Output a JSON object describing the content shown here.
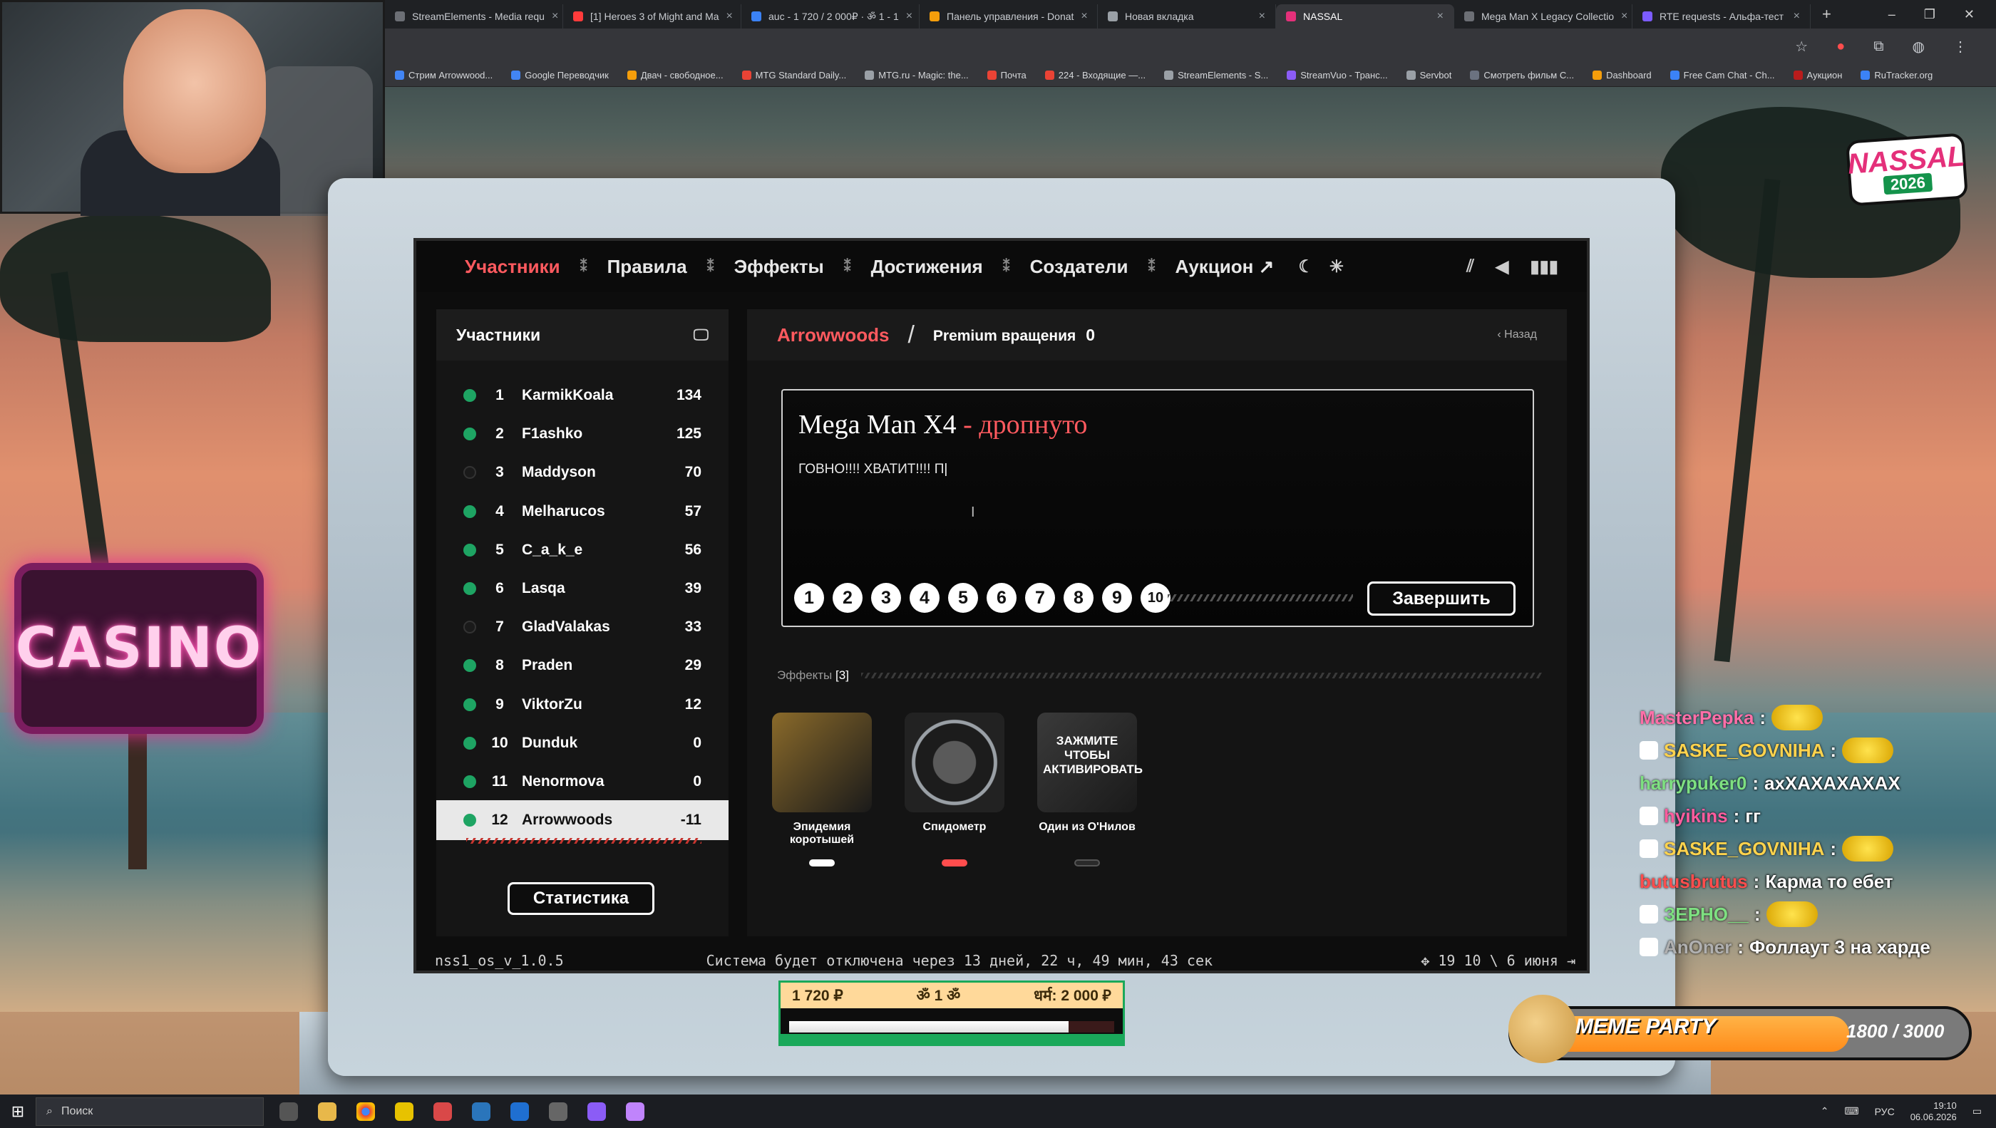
{
  "browser": {
    "tabs": [
      {
        "title": "StreamElements - Media requ",
        "color": "#6c6f75"
      },
      {
        "title": "[1] Heroes 3 of Might and Ma",
        "color": "#ff3b3b"
      },
      {
        "title": "auc - 1 720 / 2 000₽ · ॐ 1 - 1",
        "color": "#3b82f6"
      },
      {
        "title": "Панель управления - Donat",
        "color": "#f59e0b"
      },
      {
        "title": "Новая вкладка",
        "color": "#9aa0a6"
      },
      {
        "title": "NASSAL",
        "color": "#e4307a",
        "active": true
      },
      {
        "title": "Mega Man X Legacy Collectio",
        "color": "#6c6f75"
      },
      {
        "title": "RTE requests - Альфа-тест",
        "color": "#7c5cff"
      }
    ],
    "bookmarks": [
      "Стрим Arrowwood...",
      "Google Переводчик",
      "Двач - свободное...",
      "MTG Standard Daily...",
      "MTG.ru - Magic: the...",
      "Почта",
      "224 - Входящие —...",
      "StreamElements - S...",
      "StreamVuo - Транс...",
      "Servbot",
      "Смотреть фильм С...",
      "Dashboard",
      "Free Cam Chat - Ch...",
      "Аукцион",
      "RuTracker.org"
    ]
  },
  "scene": {
    "sign_text": "CASINO"
  },
  "nav": {
    "items": [
      "Участники",
      "Правила",
      "Эффекты",
      "Достижения",
      "Создатели",
      "Аукцион ↗"
    ],
    "active_index": 0
  },
  "participants": {
    "title": "Участники",
    "rows": [
      {
        "rank": "1",
        "name": "KarmikKoala",
        "score": "134",
        "online": true
      },
      {
        "rank": "2",
        "name": "F1ashko",
        "score": "125",
        "online": true
      },
      {
        "rank": "3",
        "name": "Maddyson",
        "score": "70",
        "online": false
      },
      {
        "rank": "4",
        "name": "Melharucos",
        "score": "57",
        "online": true
      },
      {
        "rank": "5",
        "name": "C_a_k_e",
        "score": "56",
        "online": true
      },
      {
        "rank": "6",
        "name": "Lasqa",
        "score": "39",
        "online": true
      },
      {
        "rank": "7",
        "name": "GladValakas",
        "score": "33",
        "online": false
      },
      {
        "rank": "8",
        "name": "Praden",
        "score": "29",
        "online": true
      },
      {
        "rank": "9",
        "name": "ViktorZu",
        "score": "12",
        "online": true
      },
      {
        "rank": "10",
        "name": "Dunduk",
        "score": "0",
        "online": true
      },
      {
        "rank": "11",
        "name": "Nenormova",
        "score": "0",
        "online": true
      },
      {
        "rank": "12",
        "name": "Arrowwoods",
        "score": "-11",
        "online": true,
        "selected": true
      }
    ],
    "stats_button": "Статистика"
  },
  "main": {
    "player": "Arrowwoods",
    "spins_label": "Premium вращения",
    "spins_value": "0",
    "back_label": "Назад",
    "game_title": "Mega Man X4",
    "game_status": " - дропнуто",
    "game_note": "ГОВНО!!!! ХВАТИТ!!!! П",
    "ratings": [
      "1",
      "2",
      "3",
      "4",
      "5",
      "6",
      "7",
      "8",
      "9",
      "10"
    ],
    "finish_button": "Завершить",
    "effects_label": "Эффекты",
    "effects_count": "[3]",
    "effects": [
      {
        "name": "Эпидемия коротышей",
        "bar_color": "#ffffff",
        "img_color": "#8a6a2a"
      },
      {
        "name": "Спидометр",
        "bar_color": "#ff4d4d",
        "img_color": "#2a2a2a"
      },
      {
        "name": "Один из О'Нилов",
        "bar_color": "#2a2a2a",
        "img_color": "#3a3a3a",
        "img_text": "ЗАЖМИТЕ ЧТОБЫ АКТИВИРОВАТЬ"
      }
    ]
  },
  "status": {
    "version": "nss1_os_v_1.0.5",
    "shutdown": "Система будет отключена через 13 дней, 22 ч, 49 мин, 43 сек",
    "clock": "19 10 \\ 6 июня"
  },
  "progress": {
    "current": "1 720 ₽",
    "center": "ॐ 1 ॐ",
    "goal": "धर्म: 2 000 ₽",
    "fraction": 0.86
  },
  "branding": {
    "line1": "NASSAL",
    "line2": "2026"
  },
  "chat": [
    {
      "user": "MasterPepka",
      "text": "",
      "color": "#ff6fa8"
    },
    {
      "user": "SASKE_GOVNIHA",
      "text": "",
      "color": "#ffd34d"
    },
    {
      "user": "harrypuker0",
      "text": "ахХАХАХАХАХ",
      "color": "#7ee081"
    },
    {
      "user": "hyikins",
      "text": "гг",
      "color": "#ff5c9e"
    },
    {
      "user": "SASKE_GOVNIHA",
      "text": "",
      "color": "#ffd34d"
    },
    {
      "user": "butusbrutus",
      "text": "Карма то ебет",
      "color": "#ff4d4d"
    },
    {
      "user": "ЗЕРНО__",
      "text": "",
      "color": "#7ee081"
    },
    {
      "user": "AnOner",
      "text": "Фоллаут 3 на харде",
      "color": "#b0b0b0"
    }
  ],
  "meme": {
    "title": "MEME PARTY",
    "count": "1800 / 3000"
  },
  "taskbar": {
    "search_placeholder": "Поиск",
    "lang": "РУС",
    "time": "19:10",
    "date": "06.06.2026"
  }
}
